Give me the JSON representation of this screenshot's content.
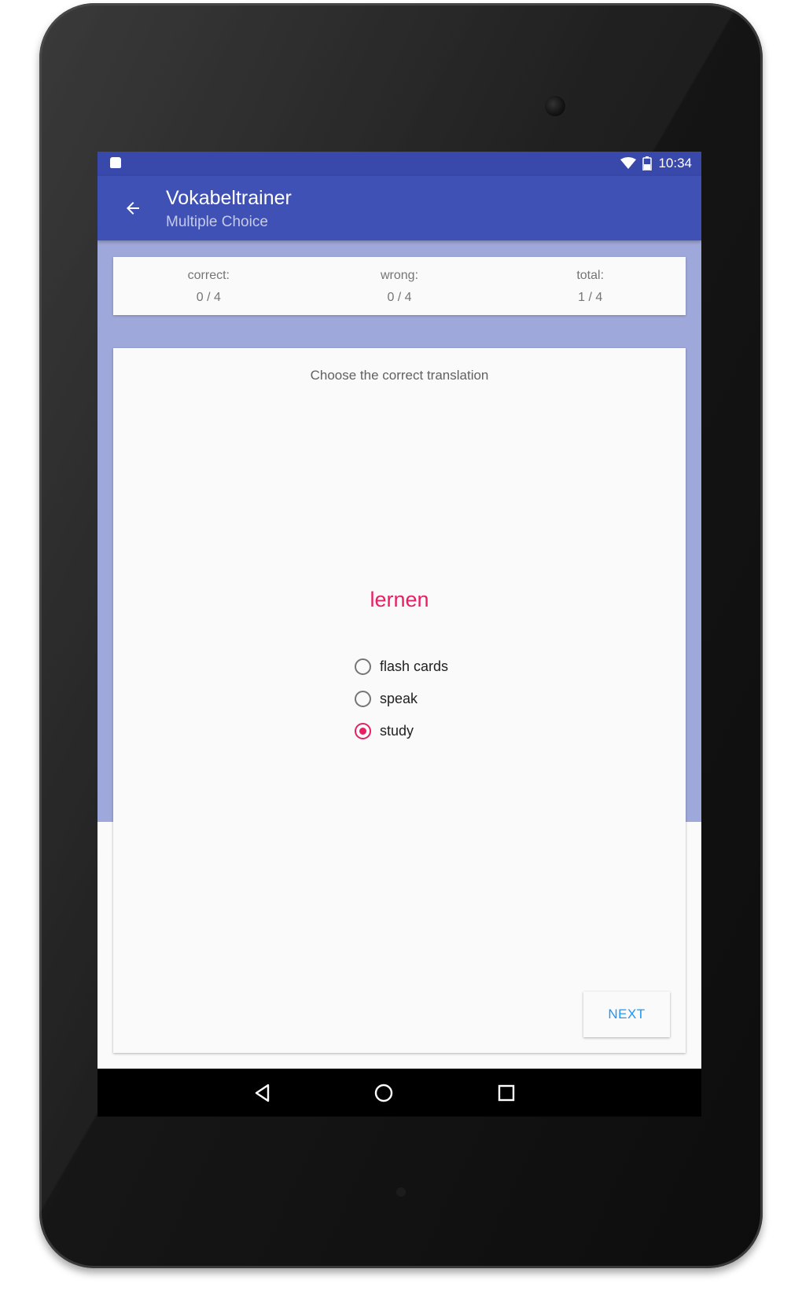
{
  "status_bar": {
    "time": "10:34",
    "icons": [
      "android-notification-icon",
      "wifi-icon",
      "battery-icon"
    ]
  },
  "toolbar": {
    "title": "Vokabeltrainer",
    "subtitle": "Multiple Choice",
    "back_icon": "arrow-left-icon"
  },
  "stats": {
    "correct": {
      "label": "correct:",
      "value": "0 / 4"
    },
    "wrong": {
      "label": "wrong:",
      "value": "0 / 4"
    },
    "total": {
      "label": "total:",
      "value": "1 / 4"
    }
  },
  "quiz": {
    "instruction": "Choose the correct translation",
    "word": "lernen",
    "options": [
      {
        "label": "flash cards",
        "selected": false
      },
      {
        "label": "speak",
        "selected": false
      },
      {
        "label": "study",
        "selected": true
      }
    ],
    "next_label": "NEXT"
  },
  "nav_bar": {
    "icons": [
      "back-triangle-icon",
      "home-circle-icon",
      "recents-square-icon"
    ]
  },
  "colors": {
    "primary": "#3f51b5",
    "primary_dark": "#3949ab",
    "primary_light": "#9fa8da",
    "accent": "#e91e63",
    "button_text": "#2196f3"
  }
}
